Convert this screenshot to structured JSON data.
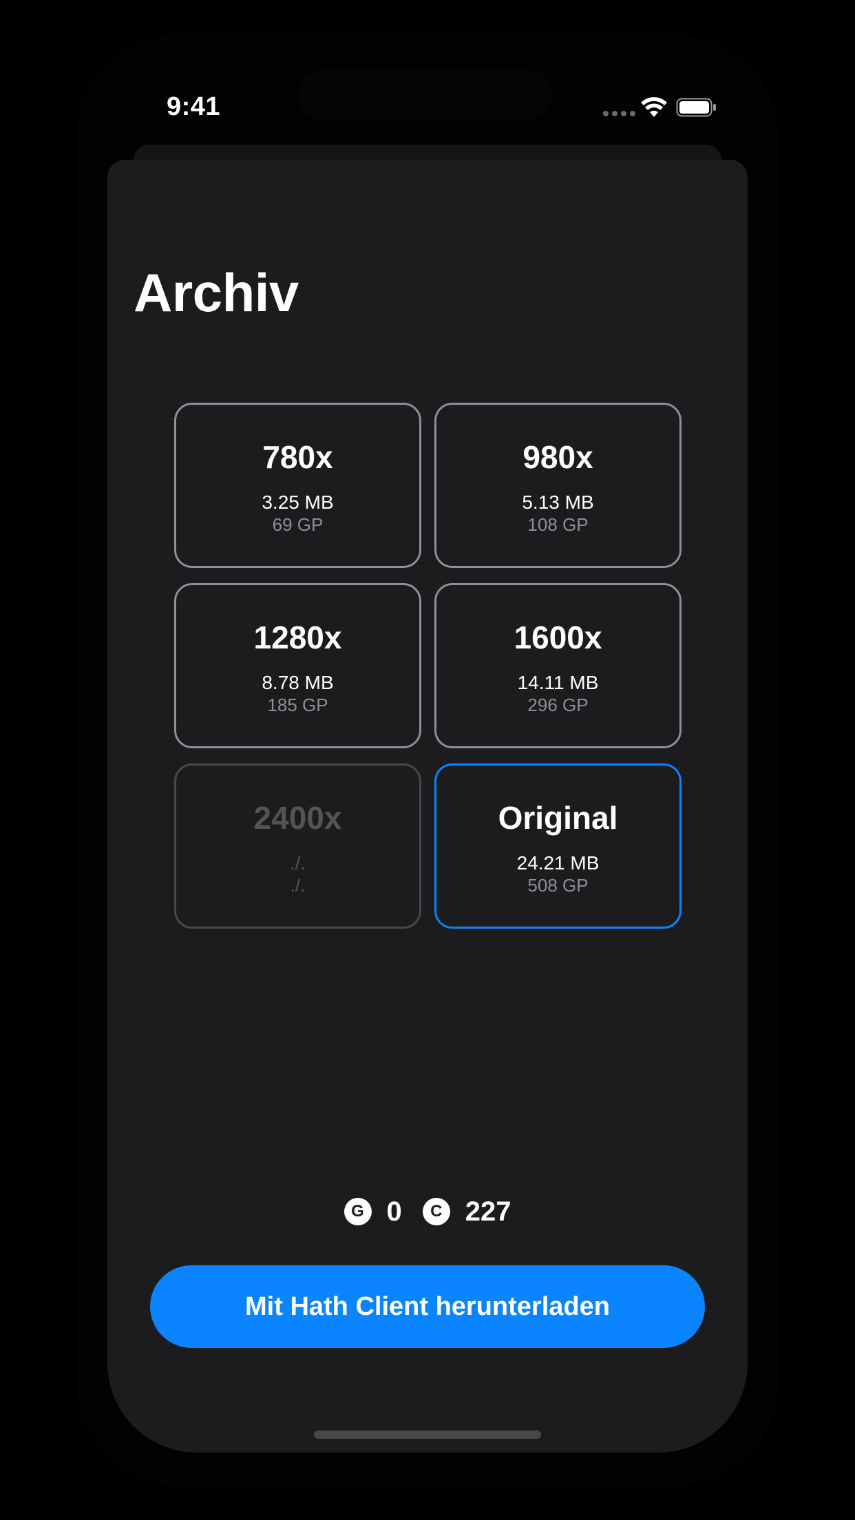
{
  "status_bar": {
    "time": "9:41"
  },
  "sheet": {
    "title": "Archiv"
  },
  "options": [
    {
      "label": "780x",
      "size": "3.25 MB",
      "cost": "69 GP",
      "state": "normal"
    },
    {
      "label": "980x",
      "size": "5.13 MB",
      "cost": "108 GP",
      "state": "normal"
    },
    {
      "label": "1280x",
      "size": "8.78 MB",
      "cost": "185 GP",
      "state": "normal"
    },
    {
      "label": "1600x",
      "size": "14.11 MB",
      "cost": "296 GP",
      "state": "normal"
    },
    {
      "label": "2400x",
      "size": "./.",
      "cost": "./.",
      "state": "disabled"
    },
    {
      "label": "Original",
      "size": "24.21 MB",
      "cost": "508 GP",
      "state": "selected"
    }
  ],
  "funds": {
    "gp": {
      "icon_letter": "G",
      "value": "0"
    },
    "credits": {
      "icon_letter": "C",
      "value": "227"
    }
  },
  "download_button": {
    "label": "Mit Hath Client herunterladen"
  },
  "colors": {
    "accent": "#0a84ff",
    "background": "#1c1c1e",
    "tile_border": "#8e8e93",
    "tile_border_disabled": "#48484a"
  },
  "icons": [
    "wifi-icon",
    "battery-icon",
    "cellular-signal-icon",
    "gp-coin-icon",
    "credits-coin-icon"
  ]
}
